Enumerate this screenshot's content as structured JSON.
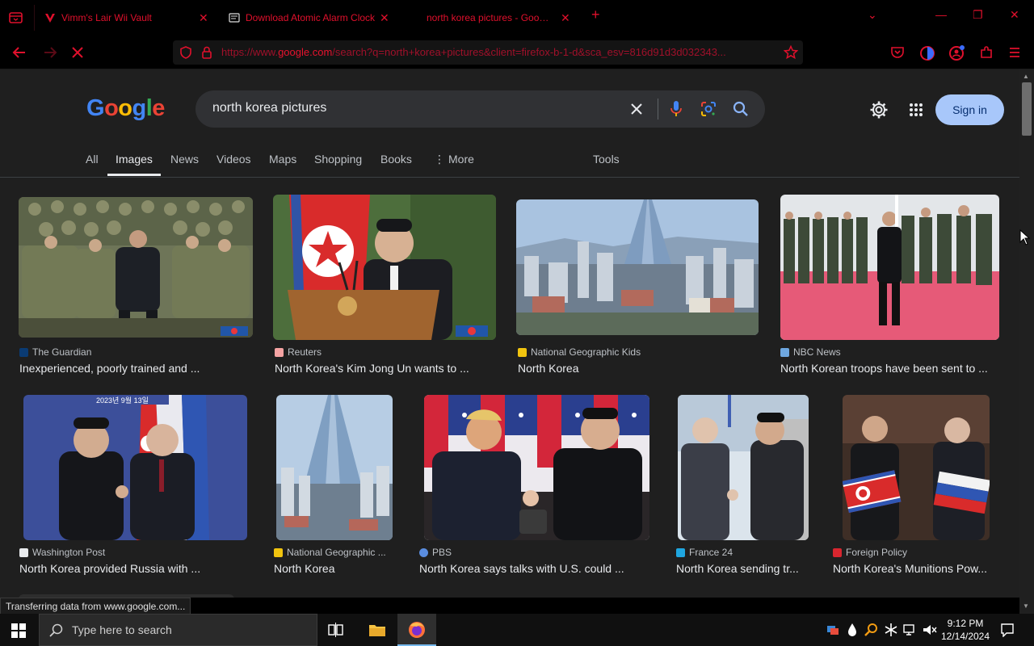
{
  "browser": {
    "tabs": [
      {
        "label": "Vimm's Lair Wii Vault"
      },
      {
        "label": "Download Atomic Alarm Clock"
      },
      {
        "label": "north korea pictures - Google Search"
      }
    ],
    "url_prefix": "https://www.",
    "url_domain": "google.com",
    "url_rest": "/search?q=north+korea+pictures&client=firefox-b-1-d&sca_esv=816d91d3d032343...",
    "accent_color": "#e0102c"
  },
  "google": {
    "logo": "Google",
    "query": "north korea pictures",
    "sign_in": "Sign in",
    "tabs": [
      "All",
      "Images",
      "News",
      "Videos",
      "Maps",
      "Shopping",
      "Books",
      "More"
    ],
    "active_tab": "Images",
    "tools": "Tools"
  },
  "results": [
    {
      "source": "The Guardian",
      "caption": "Inexperienced, poorly trained and ..."
    },
    {
      "source": "Reuters",
      "caption": "North Korea's Kim Jong Un wants to ..."
    },
    {
      "source": "National Geographic Kids",
      "caption": "North Korea"
    },
    {
      "source": "NBC News",
      "caption": "North Korean troops have been sent to ..."
    },
    {
      "source": "Washington Post",
      "caption": "North Korea provided Russia with ..."
    },
    {
      "source": "National Geographic ...",
      "caption": "North Korea"
    },
    {
      "source": "PBS",
      "caption": "North Korea says talks with U.S. could ..."
    },
    {
      "source": "France 24",
      "caption": "North Korea sending tr..."
    },
    {
      "source": "Foreign Policy",
      "caption": "North Korea's Munitions Pow..."
    }
  ],
  "thumb_banner": "2023년 9월 13일",
  "status": "Transferring data from www.google.com...",
  "taskbar": {
    "search_placeholder": "Type here to search",
    "time": "9:12 PM",
    "date": "12/14/2024"
  }
}
